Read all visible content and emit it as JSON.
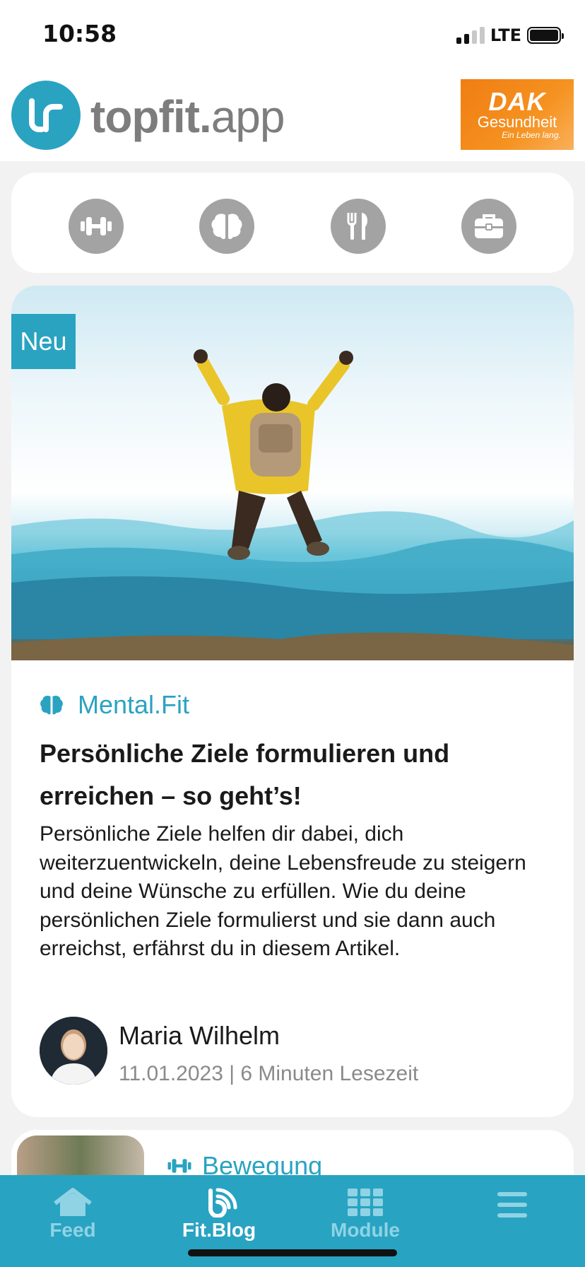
{
  "status_bar": {
    "time": "10:58",
    "network": "LTE"
  },
  "header": {
    "logo_bold": "topfit.",
    "logo_light": "app",
    "partner": {
      "name": "DAK",
      "subtitle": "Gesundheit",
      "claim": "Ein Leben lang."
    }
  },
  "categories": [
    {
      "icon": "dumbbell-icon"
    },
    {
      "icon": "brain-icon"
    },
    {
      "icon": "fork-knife-icon"
    },
    {
      "icon": "briefcase-icon"
    }
  ],
  "article": {
    "badge": "Neu",
    "category": "Mental.Fit",
    "title": "Persönliche Ziele formulieren und erreichen – so geht’s!",
    "excerpt": "Persönliche Ziele helfen dir dabei, dich weiterzuentwickeln, deine Lebensfreude zu steigern und deine Wünsche zu erfüllen. Wie du deine persönlichen Ziele formulierst und sie dann auch erreichst, erfährst du in diesem Artikel.",
    "author": "Maria Wilhelm",
    "meta": "11.01.2023 | 6 Minuten Lesezeit"
  },
  "next_article": {
    "category": "Bewegung"
  },
  "tabs": [
    {
      "label": "Feed",
      "icon": "home-icon",
      "active": false
    },
    {
      "label": "Fit.Blog",
      "icon": "blog-icon",
      "active": true
    },
    {
      "label": "Module",
      "icon": "grid-icon",
      "active": false
    },
    {
      "label": "",
      "icon": "menu-icon",
      "active": false
    }
  ],
  "colors": {
    "brand": "#2aa3c1",
    "tab_bar": "#29a3c2",
    "icon_gray": "#a3a3a3",
    "partner_orange": "#f07d13"
  }
}
